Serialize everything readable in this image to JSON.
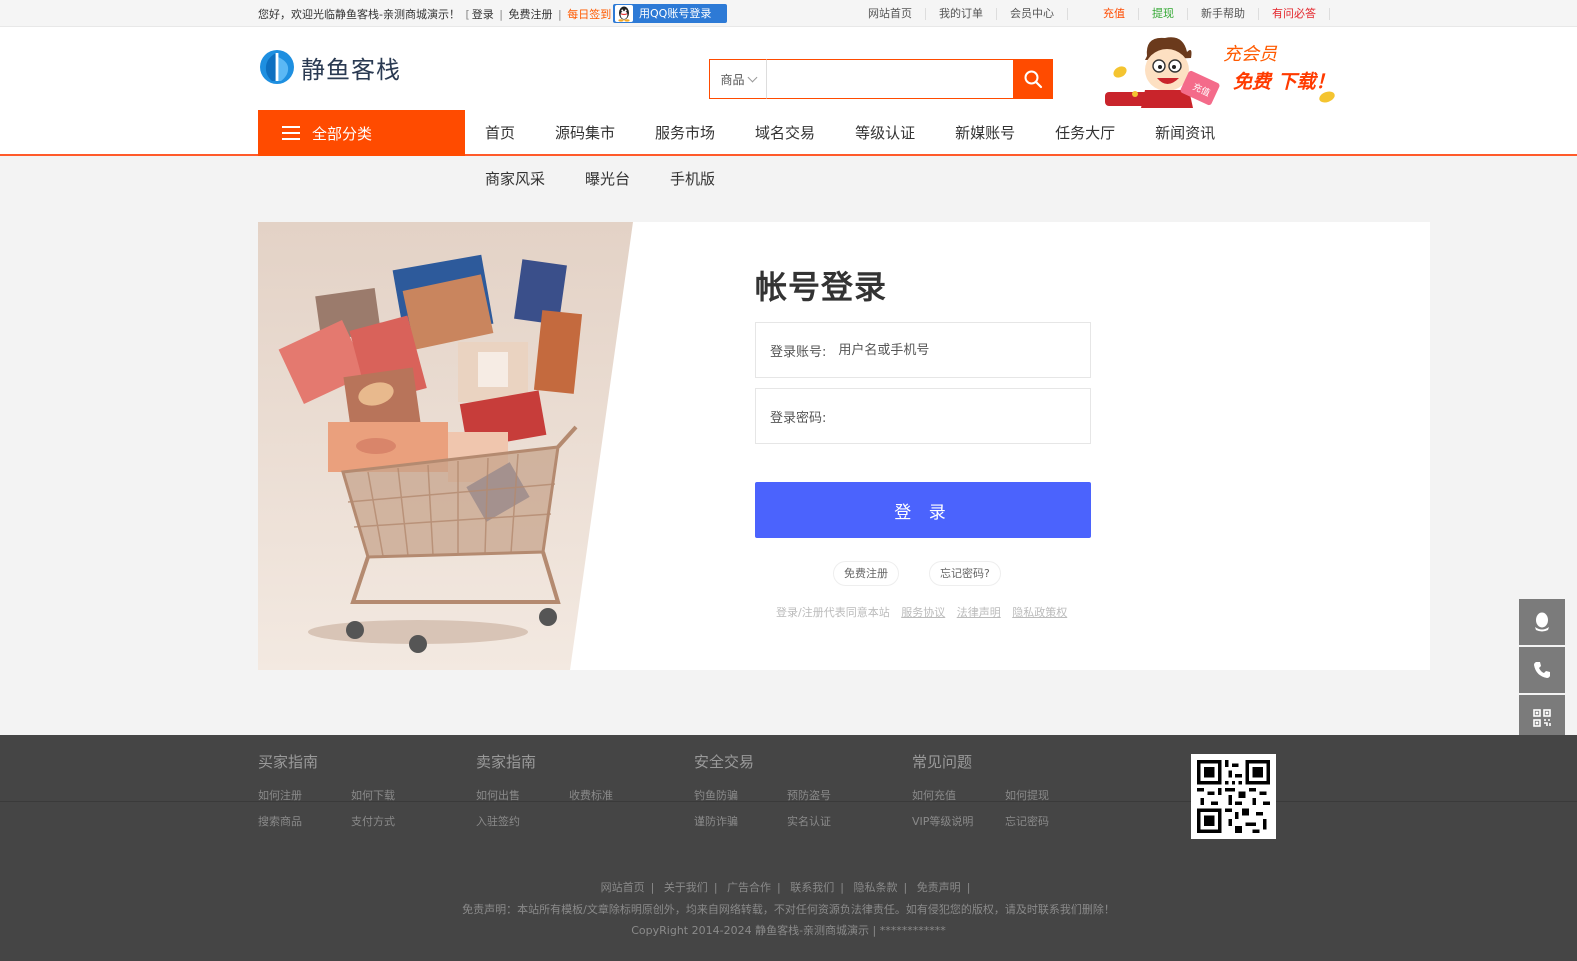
{
  "topbar": {
    "welcome": "您好，欢迎光临静鱼客栈-亲测商城演示！",
    "login": "登录",
    "register": "免费注册",
    "checkin": "每日签到",
    "qq_login": "用QQ账号登录",
    "links": [
      {
        "label": "网站首页",
        "color": "normal"
      },
      {
        "label": "我的订单",
        "color": "normal"
      },
      {
        "label": "会员中心",
        "color": "normal"
      },
      {
        "label": "充值",
        "color": "red"
      },
      {
        "label": "提现",
        "color": "green"
      },
      {
        "label": "新手帮助",
        "color": "normal"
      },
      {
        "label": "有问必答",
        "color": "crimson"
      }
    ]
  },
  "header": {
    "logo_text": "静鱼客栈",
    "search": {
      "category": "商品",
      "placeholder": "",
      "value": ""
    },
    "promo": {
      "line1": "充会员",
      "line2": "免费 下载！",
      "badge": "充值"
    }
  },
  "nav": {
    "all_categories": "全部分类",
    "items": [
      "首页",
      "源码集市",
      "服务市场",
      "域名交易",
      "等级认证",
      "新媒账号",
      "任务大厅",
      "新闻资讯"
    ],
    "sub_items": [
      "商家风采",
      "曝光台",
      "手机版"
    ]
  },
  "login": {
    "title": "帐号登录",
    "account_label": "登录账号:",
    "account_placeholder": "用户名或手机号",
    "password_label": "登录密码:",
    "password_placeholder": "",
    "submit": "登 录",
    "register": "免费注册",
    "forgot": "忘记密码?",
    "terms_prefix": "登录/注册代表同意本站",
    "terms_links": [
      "服务协议",
      "法律声明",
      "隐私政策权"
    ]
  },
  "footer": {
    "columns": [
      {
        "title": "买家指南",
        "links": [
          "如何注册",
          "如何下载",
          "搜索商品",
          "支付方式"
        ]
      },
      {
        "title": "卖家指南",
        "links": [
          "如何出售",
          "收费标准",
          "入驻签约"
        ]
      },
      {
        "title": "安全交易",
        "links": [
          "钓鱼防骗",
          "预防盗号",
          "谨防诈骗",
          "实名认证"
        ]
      },
      {
        "title": "常见问题",
        "links": [
          "如何充值",
          "如何提现",
          "VIP等级说明",
          "忘记密码"
        ]
      }
    ],
    "bottom_links": [
      "网站首页",
      "关于我们",
      "广告合作",
      "联系我们",
      "隐私条款",
      "免责声明"
    ],
    "disclaimer": "免责声明：本站所有模板/文章除标明原创外，均来自网络转载，不对任何资源负法律责任。如有侵犯您的版权，请及时联系我们删除！",
    "copyright": "CopyRight 2014-2024 静鱼客栈-亲测商城演示 | ************"
  },
  "side_tools": [
    {
      "icon": "qq-icon"
    },
    {
      "icon": "phone-icon"
    },
    {
      "icon": "qrcode-icon"
    }
  ],
  "colors": {
    "brand_orange": "#ff4b00",
    "login_button": "#4b63fd",
    "footer_bg": "#454545"
  }
}
